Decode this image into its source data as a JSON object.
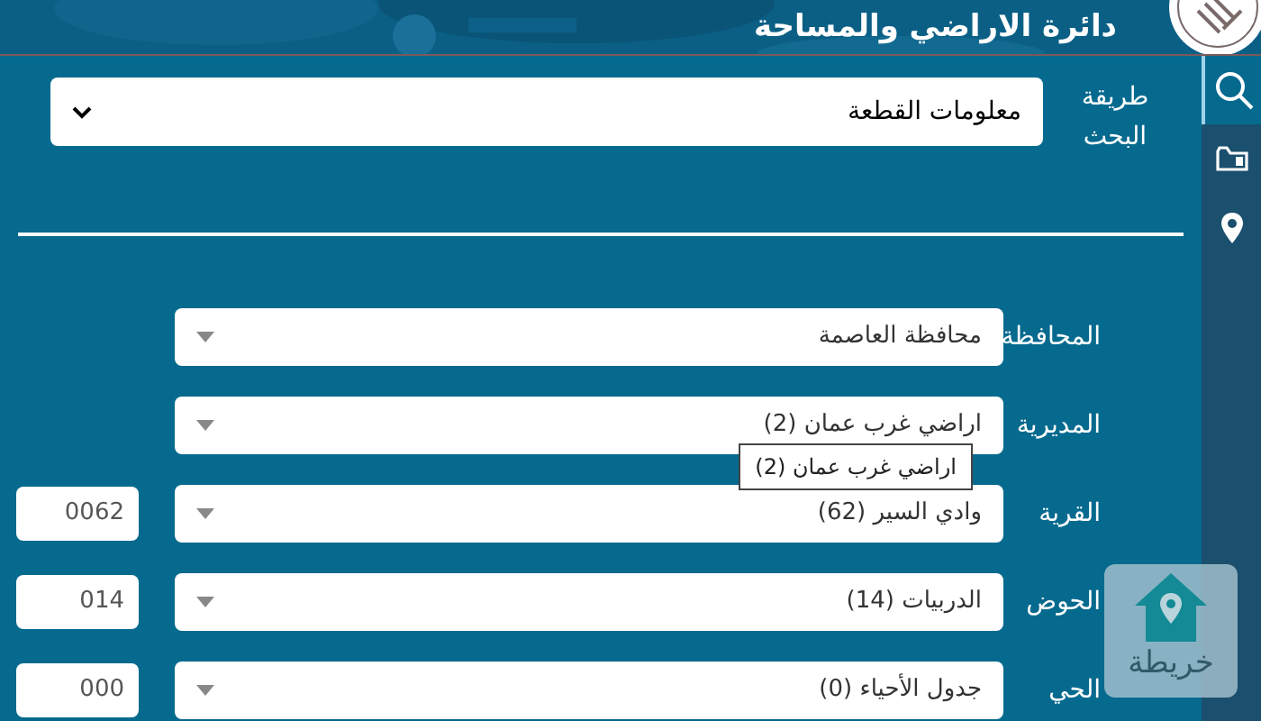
{
  "header": {
    "title": "دائرة الاراضي والمساحة"
  },
  "sidebar": {
    "items": [
      {
        "kind": "search",
        "selected": true
      },
      {
        "kind": "folder",
        "selected": false
      },
      {
        "kind": "pin",
        "selected": false
      }
    ]
  },
  "search_method": {
    "label": "طريقة البحث",
    "value": "معلومات القطعة"
  },
  "fields": [
    {
      "label": "المحافظة",
      "value": "محافظة العاصمة"
    },
    {
      "label": "المديرية",
      "value": "اراضي غرب عمان (2)"
    },
    {
      "label": "القرية",
      "value": "وادي السير (62)",
      "code": "0062"
    },
    {
      "label": "الحوض",
      "value": "الدربيات (14)",
      "code": "014"
    },
    {
      "label": "الحي",
      "value": "جدول الأحياء (0)",
      "code": "000"
    }
  ],
  "tooltip": {
    "text": "اراضي غرب عمان (2)"
  },
  "map_button": {
    "label": "خريطة"
  }
}
